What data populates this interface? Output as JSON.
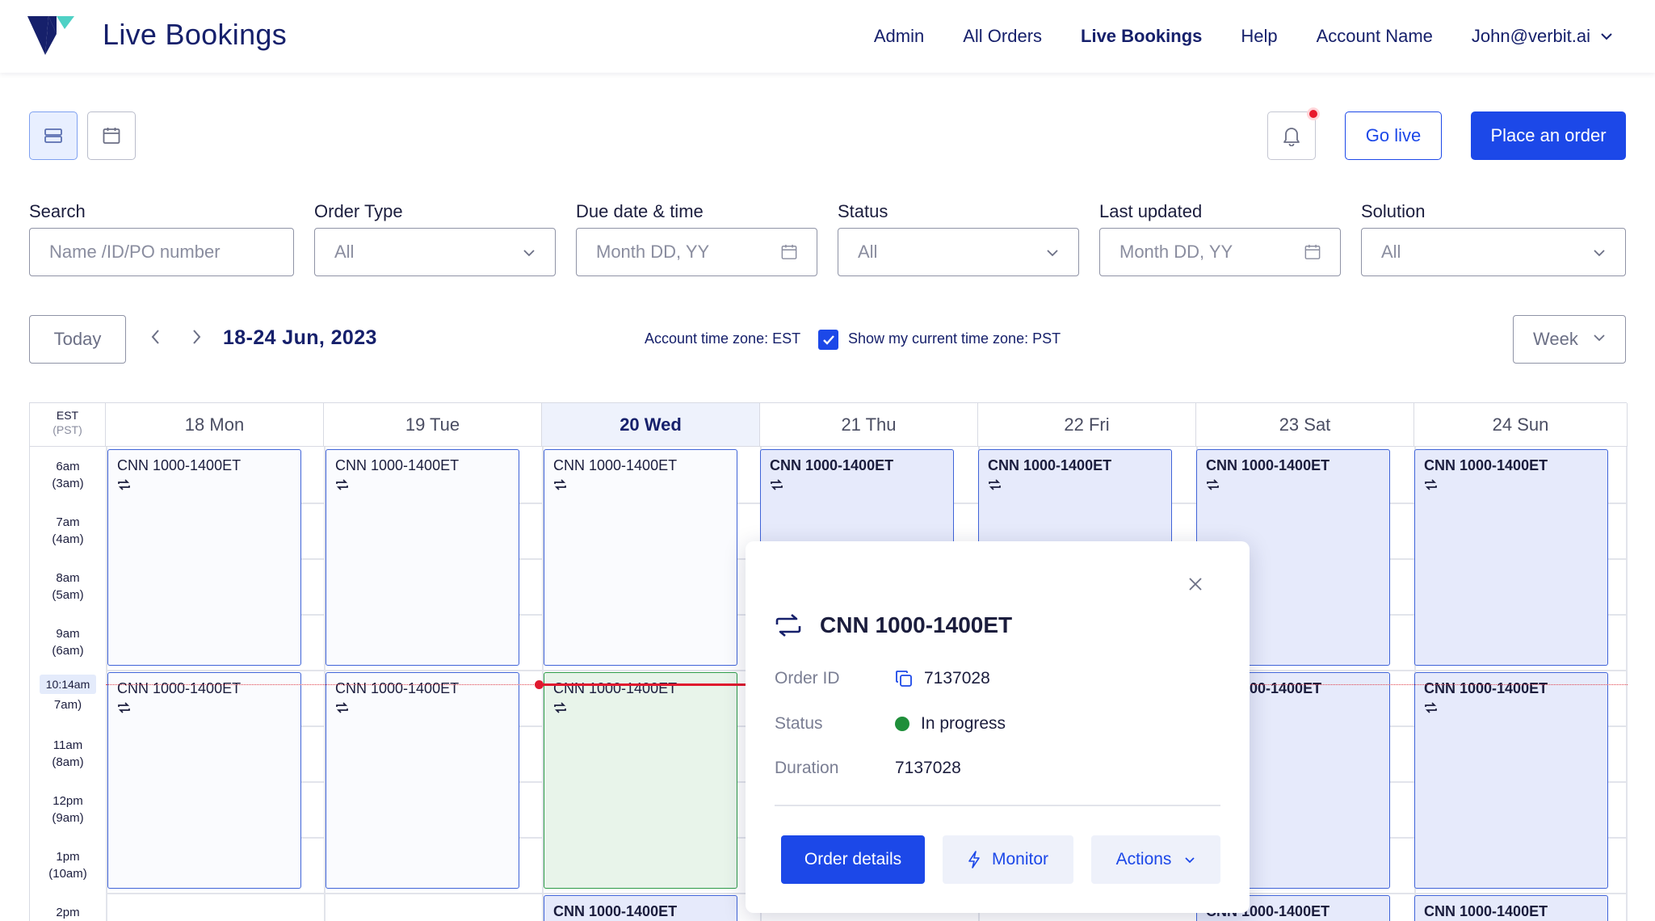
{
  "header": {
    "app_title": "Live Bookings",
    "nav": [
      "Admin",
      "All Orders",
      "Live Bookings",
      "Help",
      "Account Name"
    ],
    "user_email": "John@verbit.ai",
    "active_nav": "Live Bookings"
  },
  "toolbar": {
    "go_live_label": "Go live",
    "place_order_label": "Place an order",
    "notification_dot_color": "#e8192c"
  },
  "filters": {
    "search": {
      "label": "Search",
      "placeholder": "Name /ID/PO number"
    },
    "order_type": {
      "label": "Order Type",
      "value": "All"
    },
    "due_date": {
      "label": "Due date & time",
      "placeholder": "Month DD, YY"
    },
    "status": {
      "label": "Status",
      "value": "All"
    },
    "last_updated": {
      "label": "Last updated",
      "placeholder": "Month DD, YY"
    },
    "solution": {
      "label": "Solution",
      "value": "All"
    }
  },
  "week_nav": {
    "today_label": "Today",
    "range": "18-24 Jun, 2023",
    "account_tz": "Account time zone: EST",
    "show_tz_label": "Show my current time zone: PST",
    "show_tz_checked": true,
    "view_select": "Week"
  },
  "calendar": {
    "tz_primary": "EST",
    "tz_secondary": "(PST)",
    "days": [
      "18 Mon",
      "19 Tue",
      "20 Wed",
      "21 Thu",
      "22 Fri",
      "23 Sat",
      "24 Sun"
    ],
    "today_day": "20 Wed",
    "hours": [
      {
        "est": "6am",
        "pst": "(3am)"
      },
      {
        "est": "7am",
        "pst": "(4am)"
      },
      {
        "est": "8am",
        "pst": "(5am)"
      },
      {
        "est": "9am",
        "pst": "(6am)"
      },
      {
        "est": "",
        "pst": "7am)"
      },
      {
        "est": "11am",
        "pst": "(8am)"
      },
      {
        "est": "12pm",
        "pst": "(9am)"
      },
      {
        "est": "1pm",
        "pst": "(10am)"
      },
      {
        "est": "2pm",
        "pst": ""
      }
    ],
    "now_time": "10:14am",
    "event_title": "CNN 1000-1400ET",
    "partial_event_title": "000-1400ET"
  },
  "popover": {
    "title": "CNN 1000-1400ET",
    "order_id_label": "Order ID",
    "order_id": "7137028",
    "status_label": "Status",
    "status": "In progress",
    "status_color": "#1f8f3a",
    "duration_label": "Duration",
    "duration": "7137028",
    "order_details_label": "Order details",
    "monitor_label": "Monitor",
    "actions_label": "Actions"
  },
  "colors": {
    "brand_blue": "#1c48e8",
    "navy": "#16206b",
    "now_line": "#e0192e",
    "current_event_bg": "#e8f4ea"
  }
}
